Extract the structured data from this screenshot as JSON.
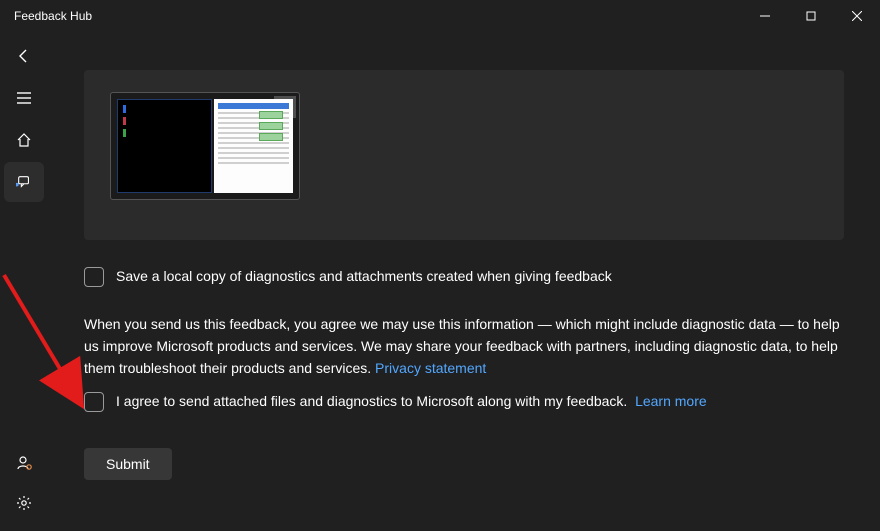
{
  "titlebar": {
    "title": "Feedback Hub"
  },
  "sidebar": {
    "back": "back-icon",
    "menu": "menu-icon",
    "home": "home-icon",
    "feedback": "feedback-icon",
    "profile": "profile-icon",
    "settings": "settings-icon"
  },
  "attachment": {
    "close_symbol": "✕"
  },
  "checkbox_save": {
    "label": "Save a local copy of diagnostics and attachments created when giving feedback"
  },
  "disclosure": {
    "text": "When you send us this feedback, you agree we may use this information — which might include diagnostic data — to help us improve Microsoft products and services. We may share your feedback with partners, including diagnostic data, to help them troubleshoot their products and services.",
    "privacy_link": "Privacy statement"
  },
  "checkbox_agree": {
    "label": "I agree to send attached files and diagnostics to Microsoft along with my feedback.",
    "learn_more": "Learn more"
  },
  "submit": {
    "label": "Submit"
  }
}
